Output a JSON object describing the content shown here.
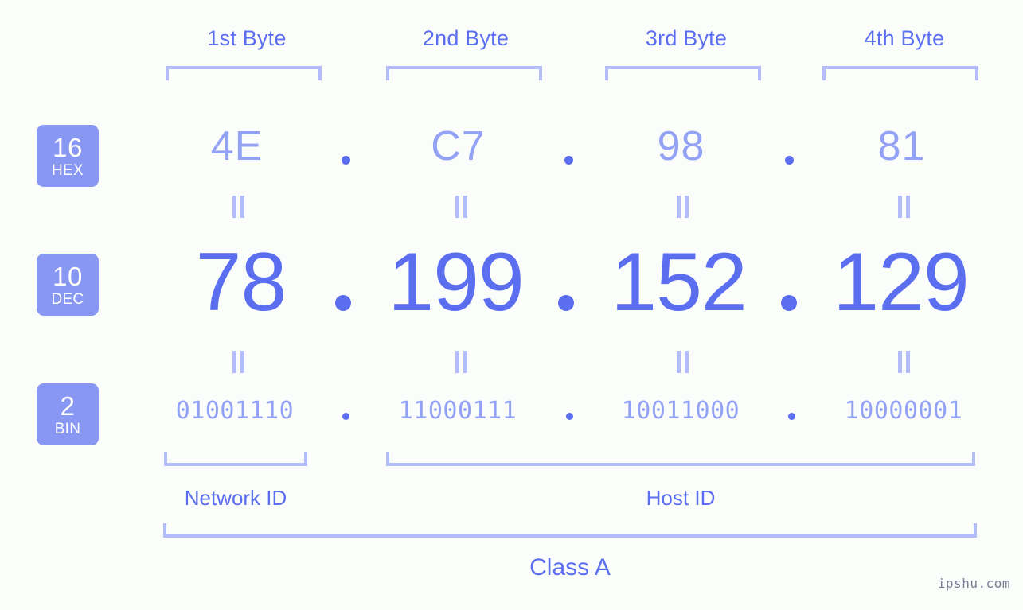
{
  "colors": {
    "background": "#fbfdfa",
    "accent_strong": "#5b6ef0",
    "accent_light": "#93a2f5",
    "bracket": "#b3bdfb",
    "badge_fill": "#8797f2",
    "badge_text": "#ffffff",
    "watermark": "#7b7f96"
  },
  "byte_headers": [
    {
      "label": "1st Byte"
    },
    {
      "label": "2nd Byte"
    },
    {
      "label": "3rd Byte"
    },
    {
      "label": "4th Byte"
    }
  ],
  "rows": {
    "hex": {
      "badge_base": "16",
      "badge_name": "HEX",
      "values": [
        "4E",
        "C7",
        "98",
        "81"
      ],
      "separator": "."
    },
    "dec": {
      "badge_base": "10",
      "badge_name": "DEC",
      "values": [
        "78",
        "199",
        "152",
        "129"
      ],
      "separator": "."
    },
    "bin": {
      "badge_base": "2",
      "badge_name": "BIN",
      "values": [
        "01001110",
        "11000111",
        "10011000",
        "10000001"
      ],
      "separator": "."
    }
  },
  "equivalence_symbol": "=",
  "sections": {
    "network_id": "Network ID",
    "host_id": "Host ID",
    "class": "Class A"
  },
  "watermark": "ipshu.com"
}
